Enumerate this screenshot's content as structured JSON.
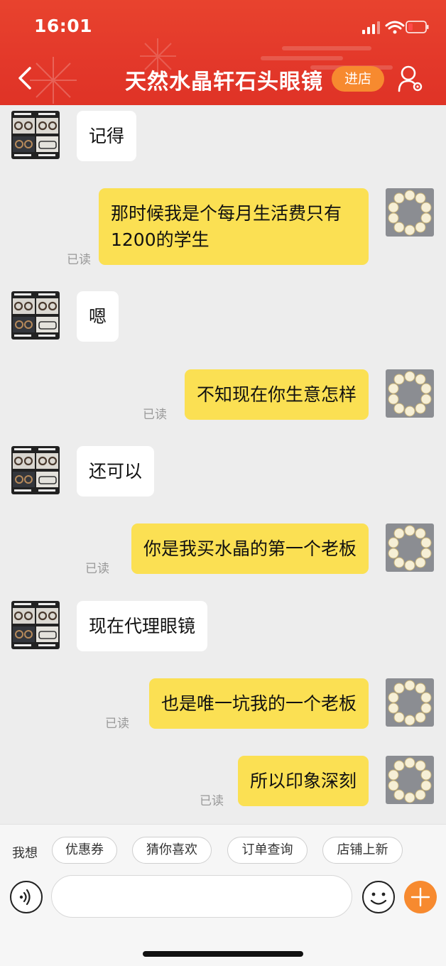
{
  "status": {
    "time": "16:01"
  },
  "header": {
    "title": "天然水晶轩石头眼镜",
    "shop_button": "进店"
  },
  "messages": [
    {
      "side": "left",
      "text": "记得"
    },
    {
      "side": "right",
      "text": "那时候我是个每月生活费只有1200的学生",
      "read": "已读"
    },
    {
      "side": "left",
      "text": "嗯"
    },
    {
      "side": "right",
      "text": "不知现在你生意怎样",
      "read": "已读"
    },
    {
      "side": "left",
      "text": "还可以"
    },
    {
      "side": "right",
      "text": "你是我买水晶的第一个老板",
      "read": "已读"
    },
    {
      "side": "left",
      "text": "现在代理眼镜"
    },
    {
      "side": "right",
      "text": "也是唯一坑我的一个老板",
      "read": "已读"
    },
    {
      "side": "right",
      "text": "所以印象深刻",
      "read": "已读"
    }
  ],
  "quick": {
    "label": "我想",
    "chips": [
      "优惠券",
      "猜你喜欢",
      "订单查询",
      "店铺上新"
    ]
  },
  "input": {
    "placeholder": ""
  },
  "icons": {
    "back": "chevron-left-icon",
    "profile": "user-settings-icon",
    "voice": "voice-icon",
    "emoji": "emoji-icon",
    "plus": "plus-icon"
  },
  "colors": {
    "header_red": "#e3382a",
    "accent_orange": "#f78a2f",
    "bubble_yellow": "#fbe053"
  }
}
